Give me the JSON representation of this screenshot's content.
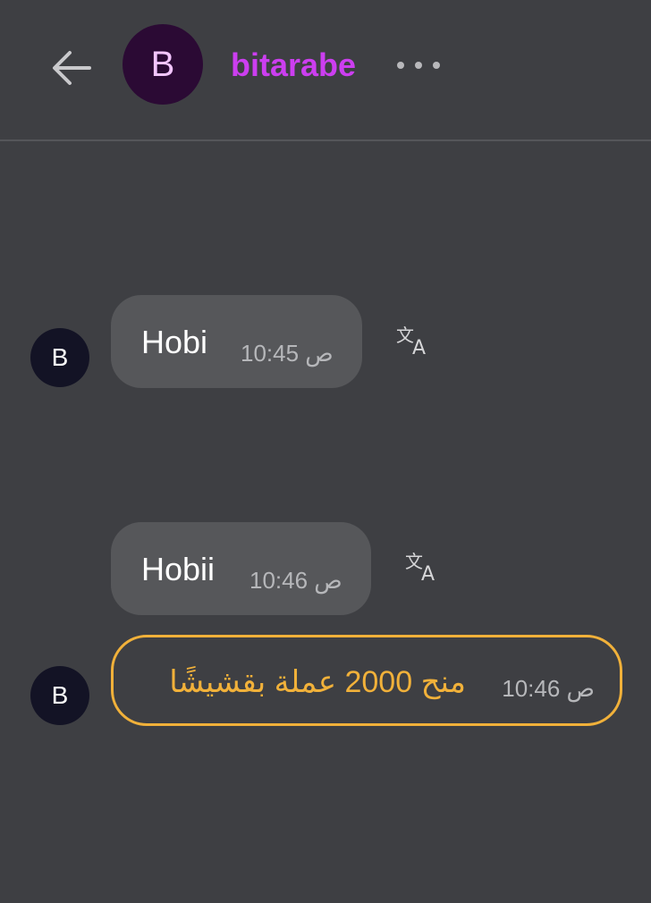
{
  "header": {
    "avatar_letter": "B",
    "name": "bitarabe"
  },
  "messages": [
    {
      "avatar_letter": "B",
      "text": "Hobi",
      "time": "ص 10:45"
    },
    {
      "text": "Hobii",
      "time": "ص 10:46"
    }
  ],
  "system_message": {
    "avatar_letter": "B",
    "text": "منح 2000 عملة بقشيشًا",
    "time": "ص 10:46"
  },
  "colors": {
    "background": "#3e3f43",
    "name_accent": "#cc3ef0",
    "system_accent": "#f1b13a",
    "bubble": "#56575a"
  },
  "icons": [
    "back-arrow-icon",
    "more-options-icon",
    "translate-icon"
  ]
}
